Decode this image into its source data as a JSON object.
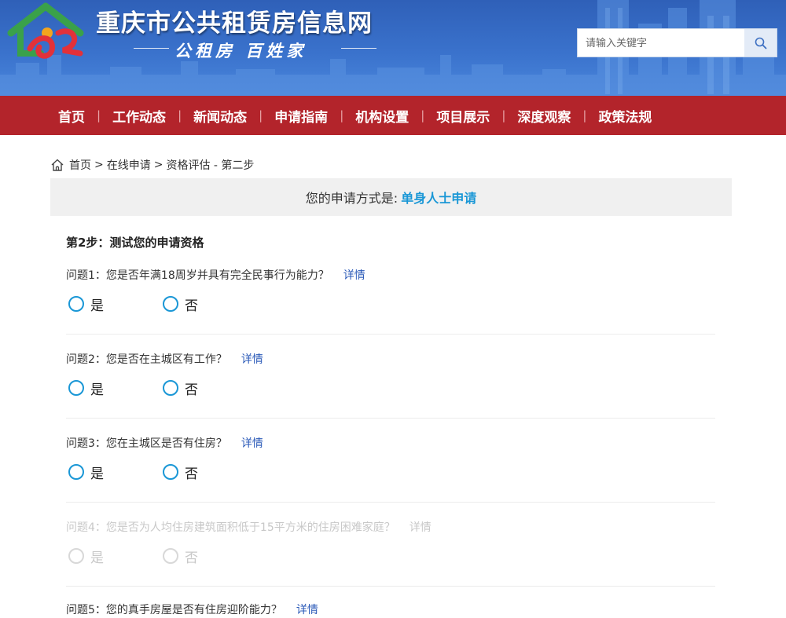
{
  "header": {
    "title": "重庆市公共租赁房信息网",
    "slogan": "公租房 百姓家",
    "search_placeholder": "请输入关键字"
  },
  "nav": [
    "首页",
    "工作动态",
    "新闻动态",
    "申请指南",
    "机构设置",
    "项目展示",
    "深度观察",
    "政策法规"
  ],
  "breadcrumb": {
    "home": "首页",
    "sep1": ">",
    "online": "在线申请",
    "sep2": ">",
    "current": "资格评估 - 第二步"
  },
  "method": {
    "label": "您的申请方式是:",
    "value": "单身人士申请"
  },
  "step_title": "第2步：测试您的申请资格",
  "questions": [
    {
      "text": "问题1：您是否年满18周岁并具有完全民事行为能力？",
      "detail": "详情",
      "yes": "是",
      "no": "否"
    },
    {
      "text": "问题2：您是否在主城区有工作？",
      "detail": "详情",
      "yes": "是",
      "no": "否"
    },
    {
      "text": "问题3：您在主城区是否有住房？",
      "detail": "详情",
      "yes": "是",
      "no": "否"
    },
    {
      "text": "问题4：您是否为人均住房建筑面积低于15平方米的住房困难家庭？",
      "detail": "详情",
      "yes": "是",
      "no": "否"
    },
    {
      "text": "问题5：您的真手房屋是否有住房迎阶能力？",
      "detail": "详情"
    }
  ],
  "colors": {
    "nav_bg": "#b3242b",
    "accent": "#1a97d6",
    "link": "#2b5ab8"
  }
}
